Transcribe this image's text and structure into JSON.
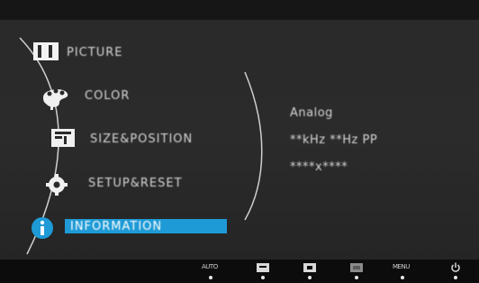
{
  "menu": {
    "items": [
      {
        "id": "picture",
        "label": "PICTURE",
        "icon": "picture-icon",
        "selected": false
      },
      {
        "id": "color",
        "label": "COLOR",
        "icon": "color-palette-icon",
        "selected": false
      },
      {
        "id": "size_position",
        "label": "SIZE&POSITION",
        "icon": "size-position-icon",
        "selected": false
      },
      {
        "id": "setup_reset",
        "label": "SETUP&RESET",
        "icon": "gear-icon",
        "selected": false
      },
      {
        "id": "information",
        "label": "INFORMATION",
        "icon": "info-icon",
        "selected": true
      }
    ]
  },
  "info": {
    "signal": "Analog",
    "frequency": "**kHz **Hz PP",
    "resolution": "****x****"
  },
  "buttons": [
    {
      "label": "AUTO",
      "icon": "auto-button-icon"
    },
    {
      "label": "",
      "icon": "menu-button-icon"
    },
    {
      "label": "",
      "icon": "down-button-icon"
    },
    {
      "label": "",
      "icon": "up-button-icon"
    },
    {
      "label": "MENU",
      "icon": "source-button-icon"
    },
    {
      "label": "",
      "icon": "power-icon"
    }
  ],
  "colors": {
    "selected_bg": "#1e9ad6",
    "text": "#d6d6d6",
    "background": "#2a2a2a"
  }
}
